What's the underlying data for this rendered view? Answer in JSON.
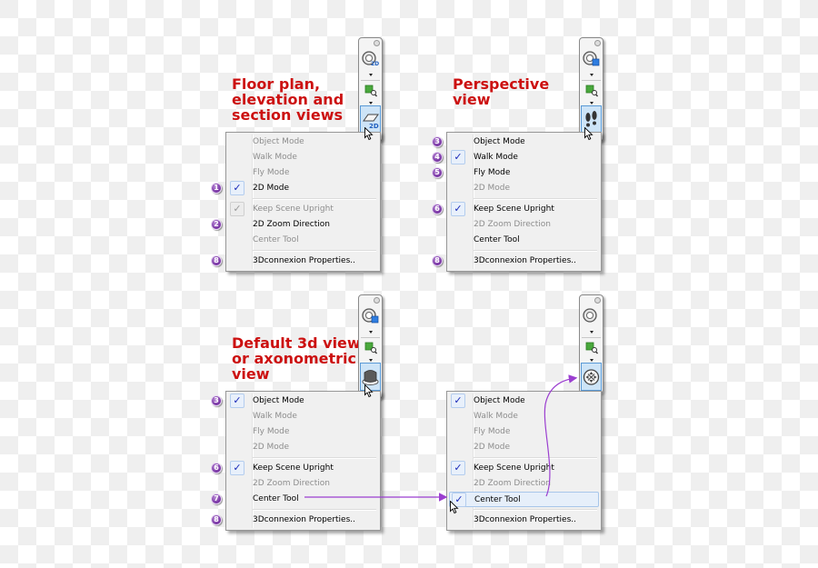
{
  "panels": [
    {
      "heading": "Floor plan,\nelevation and\nsection views",
      "toolbar": {
        "top_icon": "orbit-2d-icon",
        "mid_icon": "zoom-window-icon",
        "active_icon": "2d-mode-icon",
        "active_icon_text": "2D",
        "top_icon_text": "2D"
      },
      "menu": [
        {
          "label": "Object Mode",
          "enabled": false,
          "checked": false,
          "badge": ""
        },
        {
          "label": "Walk Mode",
          "enabled": false,
          "checked": false,
          "badge": ""
        },
        {
          "label": "Fly Mode",
          "enabled": false,
          "checked": false,
          "badge": ""
        },
        {
          "label": "2D Mode",
          "enabled": true,
          "checked": true,
          "badge": "1"
        },
        {
          "separator": true
        },
        {
          "label": "Keep Scene Upright",
          "enabled": false,
          "checked": true,
          "badge": ""
        },
        {
          "label": "2D Zoom Direction",
          "enabled": true,
          "checked": false,
          "badge": "2"
        },
        {
          "label": "Center Tool",
          "enabled": false,
          "checked": false,
          "badge": ""
        },
        {
          "separator": true
        },
        {
          "label": "3Dconnexion Properties..",
          "enabled": true,
          "checked": false,
          "badge": "8"
        }
      ]
    },
    {
      "heading": "Perspective\nview",
      "toolbar": {
        "top_icon": "orbit-3d-icon",
        "mid_icon": "zoom-window-icon",
        "active_icon": "walk-footprints-icon"
      },
      "menu": [
        {
          "label": "Object Mode",
          "enabled": true,
          "checked": false,
          "badge": "3"
        },
        {
          "label": "Walk Mode",
          "enabled": true,
          "checked": true,
          "badge": "4"
        },
        {
          "label": "Fly Mode",
          "enabled": true,
          "checked": false,
          "badge": "5"
        },
        {
          "label": "2D Mode",
          "enabled": false,
          "checked": false,
          "badge": ""
        },
        {
          "separator": true
        },
        {
          "label": "Keep Scene Upright",
          "enabled": true,
          "checked": true,
          "badge": "6"
        },
        {
          "label": "2D Zoom Direction",
          "enabled": false,
          "checked": false,
          "badge": ""
        },
        {
          "label": "Center Tool",
          "enabled": true,
          "checked": false,
          "badge": ""
        },
        {
          "separator": true
        },
        {
          "label": "3Dconnexion Properties..",
          "enabled": true,
          "checked": false,
          "badge": "8"
        }
      ]
    },
    {
      "heading": "Default 3d view\nor axonometric\nview",
      "toolbar": {
        "top_icon": "orbit-3d-icon",
        "mid_icon": "zoom-window-icon",
        "active_icon": "object-mode-icon"
      },
      "menu": [
        {
          "label": "Object Mode",
          "enabled": true,
          "checked": true,
          "badge": "3"
        },
        {
          "label": "Walk Mode",
          "enabled": false,
          "checked": false,
          "badge": ""
        },
        {
          "label": "Fly Mode",
          "enabled": false,
          "checked": false,
          "badge": ""
        },
        {
          "label": "2D Mode",
          "enabled": false,
          "checked": false,
          "badge": ""
        },
        {
          "separator": true
        },
        {
          "label": "Keep Scene Upright",
          "enabled": true,
          "checked": true,
          "badge": "6"
        },
        {
          "label": "2D Zoom Direction",
          "enabled": false,
          "checked": false,
          "badge": ""
        },
        {
          "label": "Center Tool",
          "enabled": true,
          "checked": false,
          "badge": "7"
        },
        {
          "separator": true
        },
        {
          "label": "3Dconnexion Properties..",
          "enabled": true,
          "checked": false,
          "badge": "8"
        }
      ]
    },
    {
      "heading": "",
      "toolbar": {
        "top_icon": "orbit-center-icon",
        "mid_icon": "zoom-window-icon",
        "active_icon": "center-tool-icon"
      },
      "menu": [
        {
          "label": "Object Mode",
          "enabled": true,
          "checked": true,
          "badge": ""
        },
        {
          "label": "Walk Mode",
          "enabled": false,
          "checked": false,
          "badge": ""
        },
        {
          "label": "Fly Mode",
          "enabled": false,
          "checked": false,
          "badge": ""
        },
        {
          "label": "2D Mode",
          "enabled": false,
          "checked": false,
          "badge": ""
        },
        {
          "separator": true
        },
        {
          "label": "Keep Scene Upright",
          "enabled": true,
          "checked": true,
          "badge": ""
        },
        {
          "label": "2D Zoom Direction",
          "enabled": false,
          "checked": false,
          "badge": ""
        },
        {
          "label": "Center Tool",
          "enabled": true,
          "checked": true,
          "badge": "",
          "highlight": true
        },
        {
          "separator": true
        },
        {
          "label": "3Dconnexion Properties..",
          "enabled": true,
          "checked": false,
          "badge": ""
        }
      ]
    }
  ],
  "colors": {
    "heading": "#cc1111",
    "badge": "#7d3aa8",
    "arrow": "#9b3fd0",
    "check": "#1a28b8",
    "active_button": "#cde4f7"
  }
}
